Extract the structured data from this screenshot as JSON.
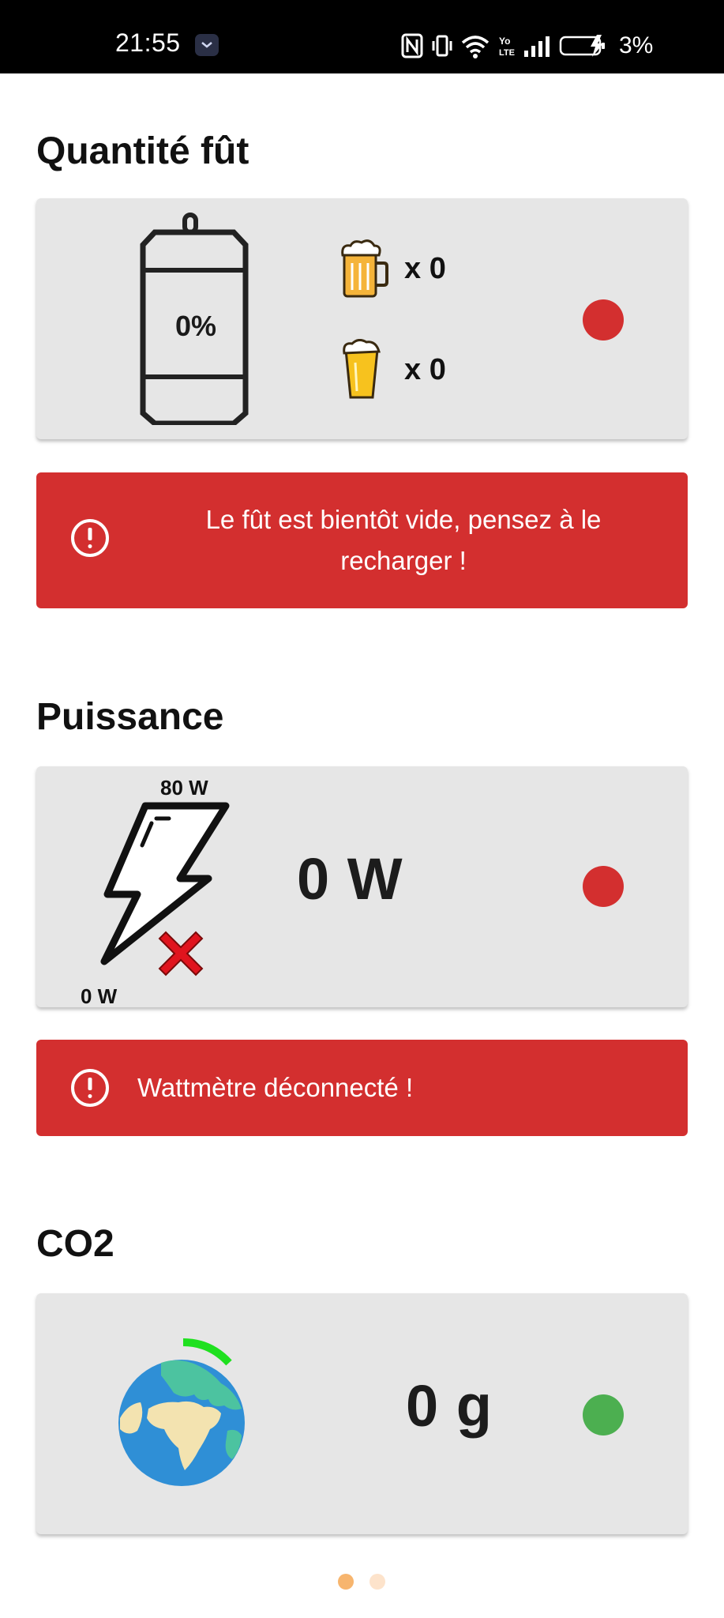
{
  "status_bar": {
    "time": "21:55",
    "battery": "3%"
  },
  "keg_section": {
    "title": "Quantité fût",
    "fill_percent": "0%",
    "mug_count": "x 0",
    "glass_count": "x 0",
    "status_color": "#d32f2f",
    "alert": "Le fût est bientôt vide, pensez à le recharger !"
  },
  "power_section": {
    "title": "Puissance",
    "gauge_max": "80 W",
    "gauge_min": "0 W",
    "value": "0 W",
    "status_color": "#d32f2f",
    "alert": "Wattmètre déconnecté !"
  },
  "co2_section": {
    "title": "CO2",
    "value": "0 g",
    "status_color": "#4caf50"
  },
  "pager": {
    "active_index": 0,
    "count": 2,
    "active_color": "#f7b56e",
    "inactive_color": "#fde3cb"
  },
  "icons": {
    "keg": "keg-icon",
    "mug": "beer-mug-icon",
    "glass": "beer-glass-icon",
    "bolt": "lightning-bolt-icon",
    "disconnected": "red-cross-icon",
    "globe": "earth-globe-icon",
    "alert": "exclamation-circle-icon"
  }
}
